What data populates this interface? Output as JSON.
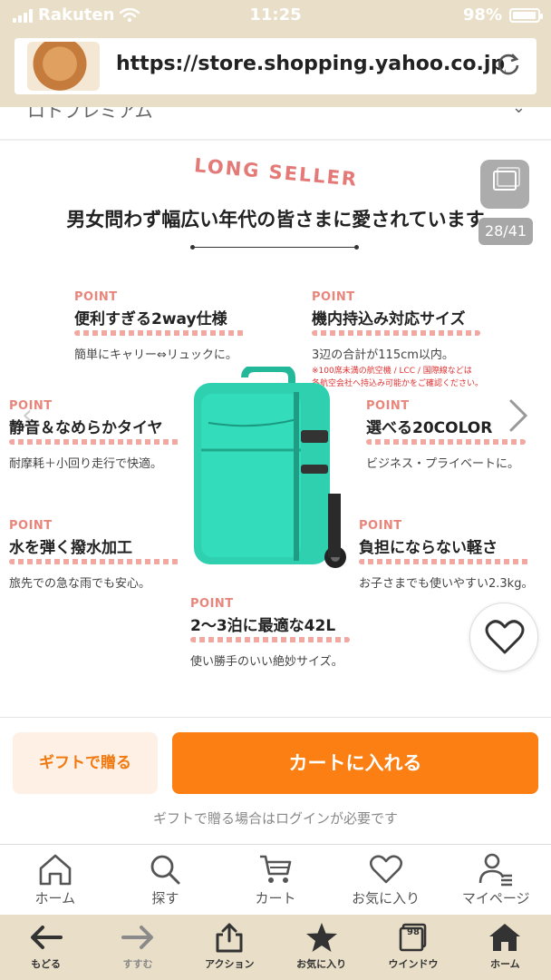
{
  "status_bar": {
    "carrier": "Rakuten",
    "time": "11:25",
    "battery_text": "98%",
    "battery_level": 0.98
  },
  "browser": {
    "url": "https://store.shopping.yahoo.co.jp/pr..."
  },
  "content": {
    "scrap_text": "ロトプレミアム",
    "badge": "LONG SELLER",
    "headline": "男女問わず幅広い年代の皆さまに愛されています",
    "image_counter": "28/41",
    "points": [
      {
        "tag": "POINT",
        "title": "便利すぎる2way仕様",
        "desc": "簡単にキャリー⇔リュックに。"
      },
      {
        "tag": "POINT",
        "title": "機内持込み対応サイズ",
        "desc": "3辺の合計が115cm以内。",
        "note1": "※100席未満の航空機 / LCC / 国際線などは",
        "note2": "各航空会社へ持込み可能かをご確認ください。"
      },
      {
        "tag": "POINT",
        "title": "静音＆なめらかタイヤ",
        "desc": "耐摩耗＋小回り走行で快適。"
      },
      {
        "tag": "POINT",
        "title": "選べる20COLOR",
        "desc": "ビジネス・プライベートに。"
      },
      {
        "tag": "POINT",
        "title": "水を弾く撥水加工",
        "desc": "旅先での急な雨でも安心。"
      },
      {
        "tag": "POINT",
        "title": "負担にならない軽さ",
        "desc": "お子さまでも使いやすい2.3kg。"
      },
      {
        "tag": "POINT",
        "title": "2〜3泊に最適な42L",
        "desc": "使い勝手のいい絶妙サイズ。"
      }
    ]
  },
  "purchase": {
    "gift_label": "ギフトで贈る",
    "cart_label": "カートに入れる",
    "login_note": "ギフトで贈る場合はログインが必要です"
  },
  "tabnav": [
    {
      "label": "ホーム",
      "icon": "home-icon"
    },
    {
      "label": "探す",
      "icon": "search-icon"
    },
    {
      "label": "カート",
      "icon": "cart-icon"
    },
    {
      "label": "お気に入り",
      "icon": "heart-icon"
    },
    {
      "label": "マイページ",
      "icon": "user-icon"
    }
  ],
  "toolbar": [
    {
      "label": "もどる",
      "icon": "back-arrow-icon"
    },
    {
      "label": "すすむ",
      "icon": "forward-arrow-icon"
    },
    {
      "label": "アクション",
      "icon": "share-icon"
    },
    {
      "label": "お気に入り",
      "icon": "star-icon"
    },
    {
      "label": "ウインドウ",
      "icon": "windows-icon",
      "count": "98"
    },
    {
      "label": "ホーム",
      "icon": "home-icon"
    }
  ],
  "colors": {
    "accent_orange": "#fb7f12",
    "gift_bg": "#fef0e4",
    "point_pink": "#e8867c",
    "toolbar_bg": "#e9dfc8",
    "suitcase": "#2fd0b0"
  }
}
